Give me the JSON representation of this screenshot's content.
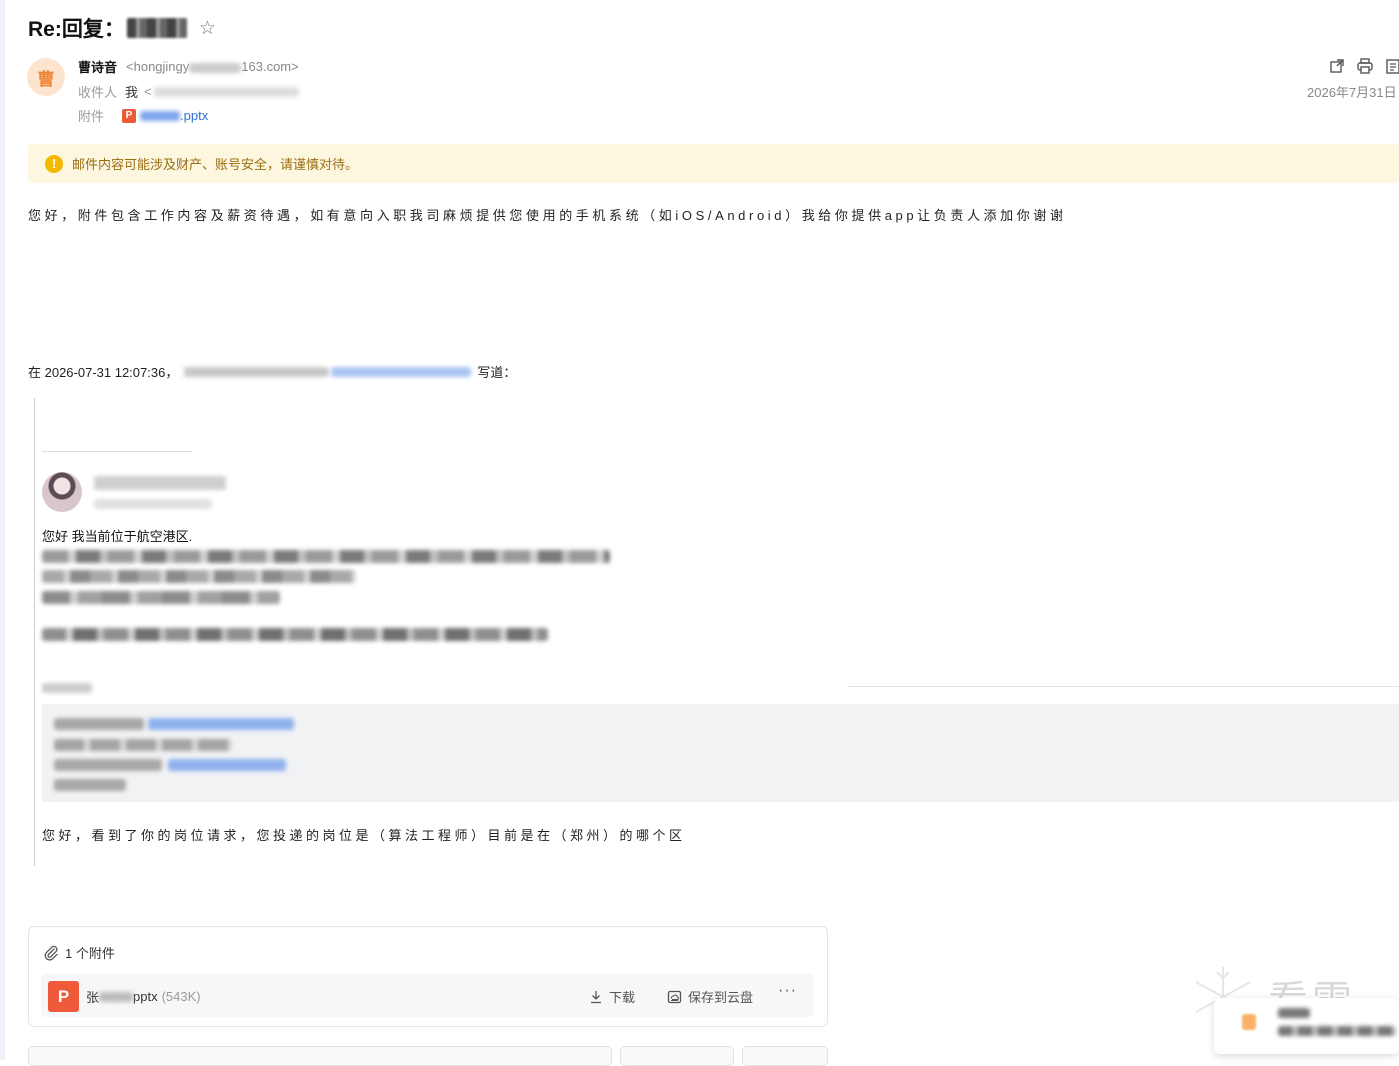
{
  "email": {
    "subject_prefix": "Re:回复：",
    "sender": {
      "avatar_char": "曹",
      "name": "曹诗音",
      "email_start": "<hongjingy",
      "email_end": "163.com>"
    },
    "recipient_label": "收件人",
    "recipient_value": "我",
    "recipient_email_start": "<",
    "attachment_label": "附件",
    "attachment_small_badge": "P",
    "attachment_short_name": ".pptx",
    "date": "2026年7月31日"
  },
  "warning": {
    "icon_char": "!",
    "text": "邮件内容可能涉及财产、账号安全，请谨慎对待。"
  },
  "body": {
    "text": "您好，附件包含工作内容及薪资待遇，如有意向入职我司麻烦提供您使用的手机系统（如iOS/Android）我给你提供app让负责人添加你谢谢"
  },
  "quote": {
    "header_prefix": "在 2026-07-31 12:07:36，",
    "header_suffix": "写道：",
    "line1": "您好 我当前位于航空港区.",
    "line2": "您好，看到了你的岗位请求，您投递的岗位是（算法工程师）目前是在（郑州）的哪个区"
  },
  "attachment_card": {
    "count_label": "1 个附件",
    "badge": "P",
    "file_prefix": "张",
    "file_suffix": "pptx",
    "file_size": "(543K)",
    "download_label": "下载",
    "save_label": "保存到云盘",
    "more_label": "···"
  },
  "watermark": {
    "text": "看雪"
  },
  "icons": {
    "star": "star-icon",
    "warning": "warning-icon",
    "paperclip": "paperclip-icon",
    "download": "download-icon",
    "cloud_save": "cloud-save-icon",
    "new_window": "new-window-icon",
    "print": "print-icon",
    "more_actions": "more-actions-icon"
  },
  "colors": {
    "warning_bg": "#fdf7df",
    "warning_text": "#9b6d12",
    "link": "#2f6ed8",
    "ppt_red": "#ee5a3a",
    "avatar_bg": "#fde4cf"
  }
}
